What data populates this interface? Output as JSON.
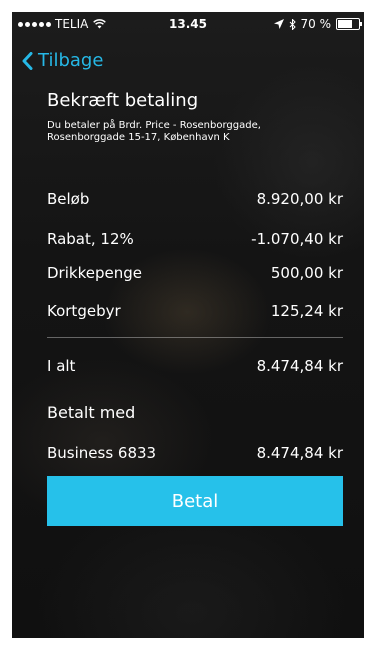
{
  "status_bar": {
    "carrier": "TELIA",
    "time": "13.45",
    "battery_text": "70 %",
    "battery_level": 0.7
  },
  "nav": {
    "back_label": "Tilbage"
  },
  "header": {
    "title": "Bekræft betaling",
    "merchant": "Du betaler på Brdr. Price - Rosenborggade, Rosenborggade 15-17, København K"
  },
  "lines": [
    {
      "label": "Beløb",
      "value": "8.920,00 kr"
    },
    {
      "label": "Rabat, 12%",
      "value": "-1.070,40 kr"
    },
    {
      "label": "Drikkepenge",
      "value": "500,00 kr"
    },
    {
      "label": "Kortgebyr",
      "value": "125,24 kr"
    }
  ],
  "total": {
    "label": "I alt",
    "value": "8.474,84 kr"
  },
  "paid_with": {
    "heading": "Betalt med",
    "card_label": "Business 6833",
    "amount": "8.474,84 kr"
  },
  "pay_button": {
    "label": "Betal",
    "color": "#26c1ea"
  },
  "colors": {
    "accent": "#26b8e6"
  }
}
